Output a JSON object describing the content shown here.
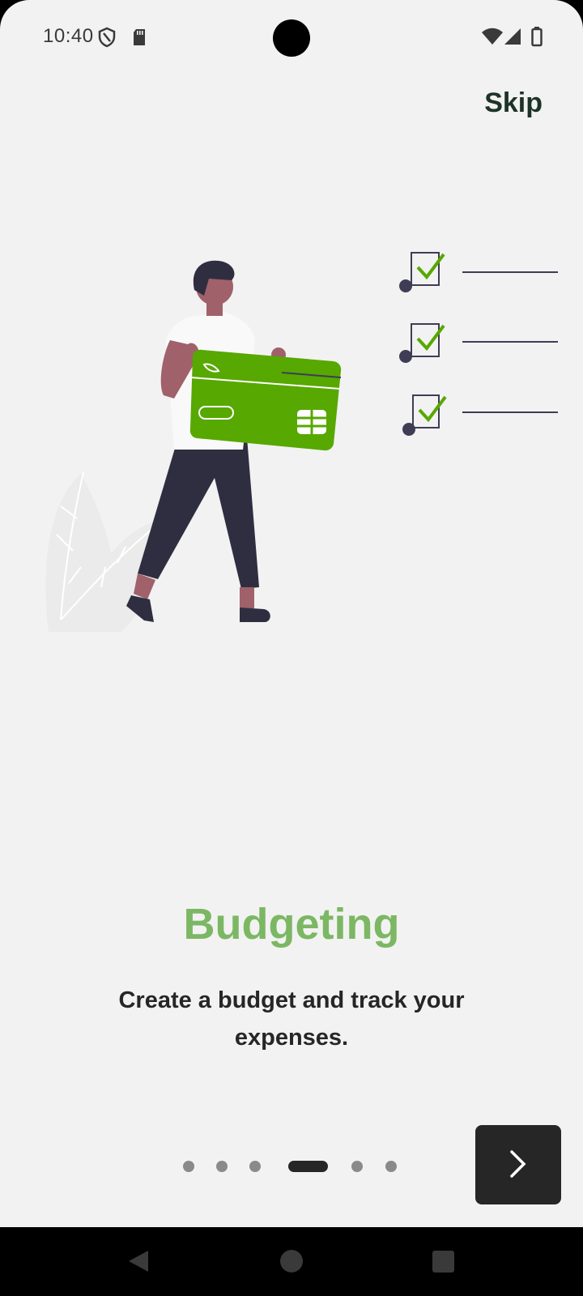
{
  "status_bar": {
    "time": "10:40",
    "icons": [
      "shield-icon",
      "sd-card-icon",
      "wifi-icon",
      "signal-icon",
      "battery-icon"
    ]
  },
  "header": {
    "skip_label": "Skip"
  },
  "illustration": {
    "name": "person-holding-credit-card-illustration",
    "colors": {
      "card": "#57a800",
      "check": "#57a800",
      "pants": "#2f2e41",
      "skin": "#a0616a"
    }
  },
  "onboarding": {
    "title": "Budgeting",
    "description": "Create a budget and track your expenses."
  },
  "pagination": {
    "total_pages": 6,
    "current_page": 4
  },
  "footer": {
    "next_icon": "chevron-right-icon"
  },
  "nav_bar": {
    "items": [
      "back-icon",
      "home-icon",
      "recents-icon"
    ]
  },
  "colors": {
    "background": "#f2f2f2",
    "accent": "#7cb763",
    "dark": "#262626",
    "skip": "#1d3327"
  }
}
